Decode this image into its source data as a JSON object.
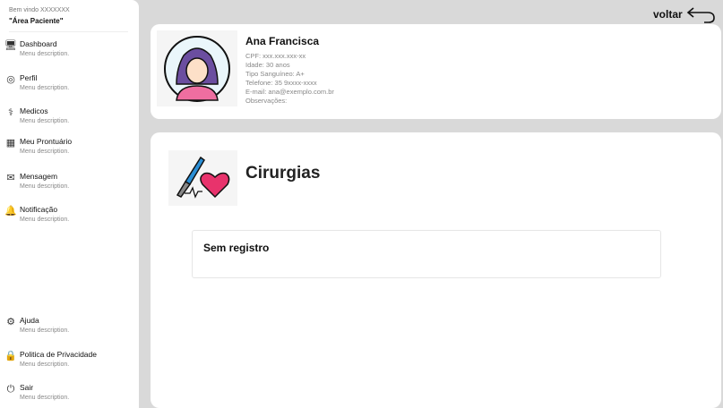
{
  "sidebar": {
    "welcome": "Bem vindo XXXXXXX",
    "area": "\"Área Paciente\"",
    "items": [
      {
        "label": "Dashboard",
        "desc": "Menu description.",
        "icon": "dashboard-icon"
      },
      {
        "label": "Perfil",
        "desc": "Menu description.",
        "icon": "user-icon"
      },
      {
        "label": "Medicos",
        "desc": "Menu description.",
        "icon": "doctors-icon"
      },
      {
        "label": "Meu Prontuário",
        "desc": "Menu description.",
        "icon": "records-icon"
      },
      {
        "label": "Mensagem",
        "desc": "Menu description.",
        "icon": "messages-icon"
      },
      {
        "label": "Notificação",
        "desc": "Menu description.",
        "icon": "bell-icon"
      },
      {
        "label": "Ajuda",
        "desc": "Menu description.",
        "icon": "help-icon"
      },
      {
        "label": "Politica de Privacidade",
        "desc": "Menu description.",
        "icon": "lock-icon"
      },
      {
        "label": "Sair",
        "desc": "Menu description.",
        "icon": "power-icon"
      }
    ]
  },
  "header": {
    "back_label": "voltar"
  },
  "profile": {
    "name": "Ana Francisca",
    "cpf": "CPF: xxx.xxx.xxx-xx",
    "age": "Idade: 30 anos",
    "blood": "Tipo Sanguíneo: A+",
    "phone": "Telefone: 35 9xxxx-xxxx",
    "email": "E-mail: ana@exemplo.com.br",
    "notes": "Observações:"
  },
  "section": {
    "title": "Cirurgias",
    "empty": "Sem registro"
  }
}
